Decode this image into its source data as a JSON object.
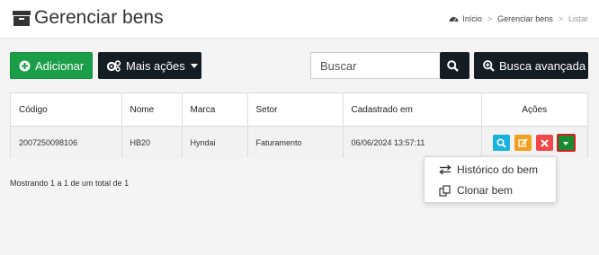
{
  "header": {
    "title": "Gerenciar bens",
    "title_icon": "archive-box-icon",
    "breadcrumb": [
      "Início",
      "Gerenciar bens",
      "Listar"
    ],
    "breadcrumb_sep": ">"
  },
  "toolbar": {
    "add_label": "Adicionar",
    "more_label": "Mais ações",
    "search_placeholder": "Buscar",
    "search_value": "",
    "advanced_label": "Busca avançada"
  },
  "table": {
    "columns": [
      "Código",
      "Nome",
      "Marca",
      "Setor",
      "Cadastrado em",
      "Ações"
    ],
    "rows": [
      [
        "2007250098106",
        "HB20",
        "Hyndai",
        "Faturamento",
        "06/06/2024 13:57:11"
      ]
    ]
  },
  "summary": "Mostrando 1 a 1 de um total de 1",
  "dropdown": {
    "items": [
      {
        "label": "Histórico do bem",
        "icon": "swap-arrows-icon"
      },
      {
        "label": "Clonar bem",
        "icon": "clone-icon"
      }
    ]
  },
  "colors": {
    "add": "#1a9e48",
    "dark": "#141c24",
    "view": "#1ab0e0",
    "edit": "#f0a020",
    "delete": "#f04848",
    "more": "#1a8a30",
    "highlight": "#d02020"
  }
}
